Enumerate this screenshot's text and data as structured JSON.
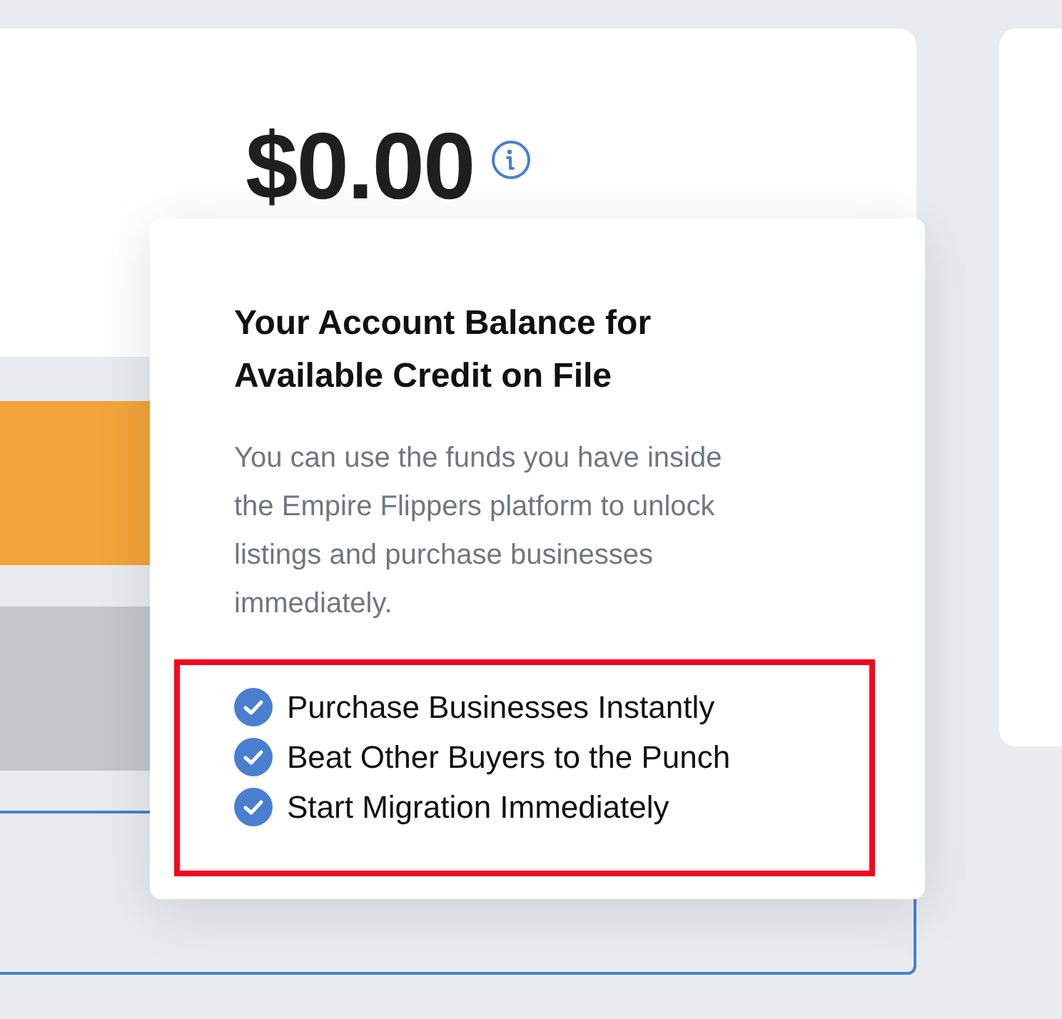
{
  "balance": {
    "amount": "$0.00"
  },
  "popover": {
    "title": "Your Account Balance for Available Credit on File",
    "description": "You can use the funds you have inside the Empire Flippers platform to unlock listings and purchase businesses immediately.",
    "highlighted": true,
    "benefits": [
      {
        "label": "Purchase Businesses Instantly",
        "checked": true
      },
      {
        "label": "Beat Other Buyers to the Punch",
        "checked": true
      },
      {
        "label": "Start Migration Immediately",
        "checked": true
      }
    ]
  }
}
